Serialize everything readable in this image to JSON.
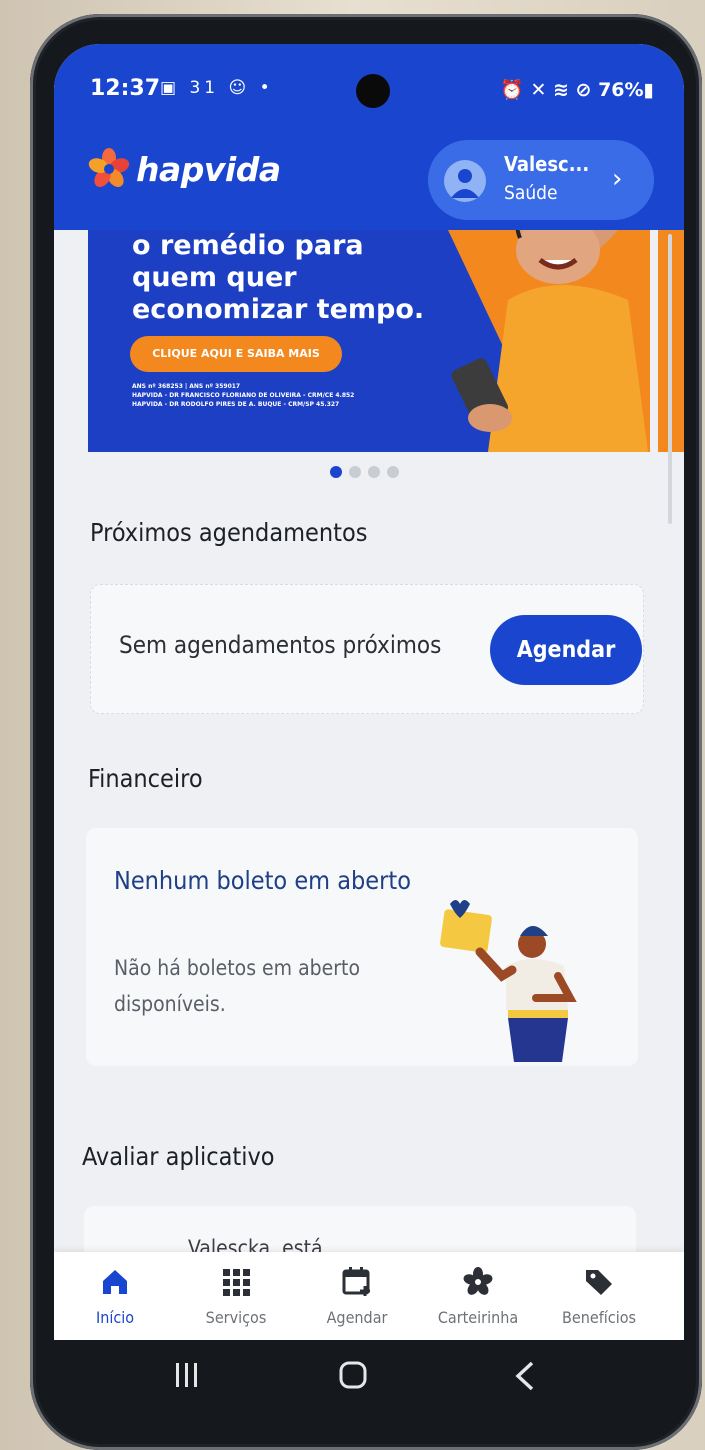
{
  "status_bar": {
    "time": "12:37",
    "left_icons": "▣ 31 ☺ •",
    "right_text": "⏰ ✕ ≋ ⊘ 76%▮"
  },
  "header": {
    "brand": "hapvida",
    "user_name": "Valesc...",
    "user_plan": "Saúde"
  },
  "banner": {
    "headline": "o remédio para quem quer economizar tempo.",
    "cta": "CLIQUE AQUI E SAIBA MAIS",
    "legal_line1": "ANS nº 368253 | ANS nº 359017",
    "legal_line2": "HAPVIDA - DR FRANCISCO FLORIANO DE OLIVEIRA - CRM/CE 4.852",
    "legal_line3": "HAPVIDA - DR RODOLFO PIRES DE A. BUQUE - CRM/SP 45.327"
  },
  "carousel": {
    "count": 4,
    "active_index": 0
  },
  "appointments": {
    "title": "Próximos agendamentos",
    "empty_text": "Sem agendamentos próximos",
    "button": "Agendar"
  },
  "financial": {
    "title": "Financeiro",
    "card_title": "Nenhum boleto em aberto",
    "card_desc": "Não há boletos em aberto disponíveis."
  },
  "rate_app": {
    "title": "Avaliar aplicativo",
    "text": "Valescka, está"
  },
  "bottom_nav": {
    "items": [
      {
        "label": "Início",
        "icon": "home-icon",
        "active": true
      },
      {
        "label": "Serviços",
        "icon": "grid-icon",
        "active": false
      },
      {
        "label": "Agendar",
        "icon": "calendar-add-icon",
        "active": false
      },
      {
        "label": "Carteirinha",
        "icon": "flower-card-icon",
        "active": false
      },
      {
        "label": "Benefícios",
        "icon": "tag-icon",
        "active": false
      }
    ]
  },
  "colors": {
    "brand_blue": "#1a46cf",
    "accent_orange": "#f3891e",
    "title_blue": "#1f3f86"
  }
}
